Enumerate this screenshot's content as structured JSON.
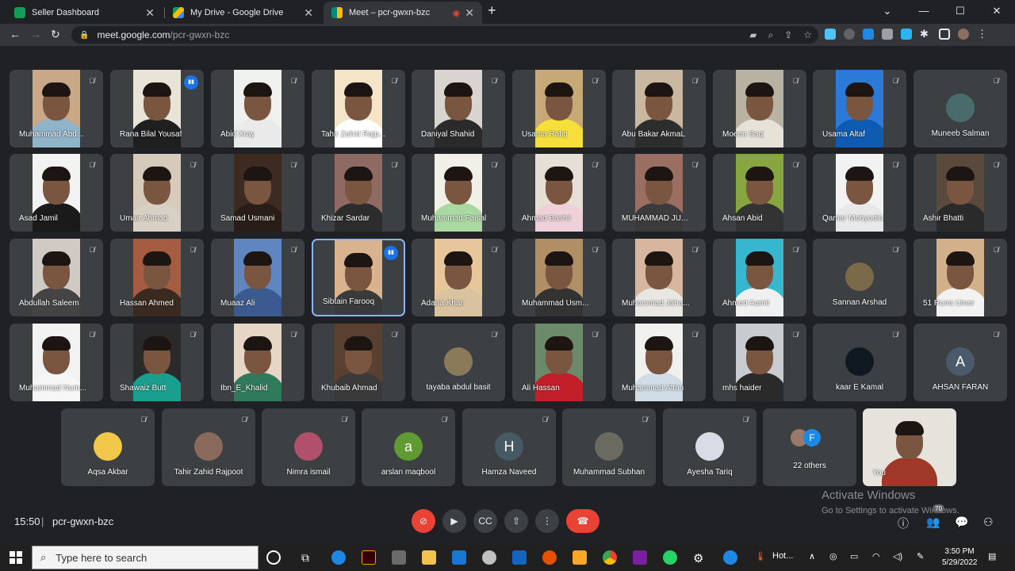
{
  "browser": {
    "tabs": [
      {
        "label": "Seller Dashboard",
        "favicon_color": "#0f9d58"
      },
      {
        "label": "My Drive - Google Drive",
        "favicon_color": "#fbbc04"
      },
      {
        "label": "Meet – pcr-gwxn-bzc",
        "favicon_color": "#00897b",
        "active": true
      }
    ],
    "url_host": "meet.google.com",
    "url_path": "/pcr-gwxn-bzc"
  },
  "meet": {
    "participants": [
      {
        "name": "Muhammad Abd...",
        "row": 1,
        "col": 1,
        "bg": "#c9a887",
        "shirt": "#8fb3c9"
      },
      {
        "name": "Rana Bilal Yousaf",
        "row": 1,
        "col": 2,
        "bg": "#e9e4d8",
        "shirt": "#1f1f1f",
        "speaking": true
      },
      {
        "name": "Abid Xray",
        "row": 1,
        "col": 3,
        "bg": "#f0f0ee",
        "shirt": "#eaeaea"
      },
      {
        "name": "Tahir Zahid Rajp...",
        "row": 1,
        "col": 4,
        "bg": "#f4e4c8",
        "shirt": "#ffffff"
      },
      {
        "name": "Daniyal Shahid",
        "row": 1,
        "col": 5,
        "bg": "#d8d4cf",
        "shirt": "#2a2a2a"
      },
      {
        "name": "Usama Rafiq",
        "row": 1,
        "col": 6,
        "bg": "#c7a978",
        "shirt": "#f6df3a"
      },
      {
        "name": "Abu Bakar AkmaL",
        "row": 1,
        "col": 7,
        "bg": "#c9b7a0",
        "shirt": "#2d2d2d"
      },
      {
        "name": "Moeen Saqi",
        "row": 1,
        "col": 8,
        "bg": "#b9b1a1",
        "shirt": "#e6e2d8"
      },
      {
        "name": "Usama Altaf",
        "row": 1,
        "col": 9,
        "bg": "#2b7ad9",
        "shirt": "#0e5bb3"
      },
      {
        "name": "Muneeb Salman",
        "row": 1,
        "col": 10,
        "avatar_color": "#4a6b6b"
      },
      {
        "name": "Asad Jamil",
        "row": 2,
        "col": 1,
        "bg": "#f2f2f2",
        "shirt": "#1a1a1a"
      },
      {
        "name": "Umair Ahmad",
        "row": 2,
        "col": 2,
        "bg": "#d6cabc",
        "shirt": "#d8d0c2"
      },
      {
        "name": "Samad Usmani",
        "row": 2,
        "col": 3,
        "bg": "#3d2b22",
        "shirt": "#2a1d17"
      },
      {
        "name": "Khizar Sardar",
        "row": 2,
        "col": 4,
        "bg": "#8e6a63",
        "shirt": "#2c2c2c"
      },
      {
        "name": "Muhammad Faisal",
        "row": 2,
        "col": 5,
        "bg": "#f0efe8",
        "shirt": "#a9d8a0"
      },
      {
        "name": "Ahmad Bashir",
        "row": 2,
        "col": 6,
        "bg": "#e6dfd6",
        "shirt": "#f0d0d8"
      },
      {
        "name": "MUHAMMAD JU...",
        "row": 2,
        "col": 7,
        "bg": "#9a6f62",
        "shirt": "#3b3b3b"
      },
      {
        "name": "Ahsan Abid",
        "row": 2,
        "col": 8,
        "bg": "#87a63f",
        "shirt": "#333333"
      },
      {
        "name": "Qamar Mohyodin",
        "row": 2,
        "col": 9,
        "bg": "#f2f2f2",
        "shirt": "#e8e8e8"
      },
      {
        "name": "Ashir Bhatti",
        "row": 2,
        "col": 10,
        "bg": "#5a4a3e",
        "shirt": "#2a2a2a"
      },
      {
        "name": "Abdullah Saleem",
        "row": 3,
        "col": 1,
        "bg": "#cfcac4",
        "shirt": "#444444"
      },
      {
        "name": "Hassan Ahmed",
        "row": 3,
        "col": 2,
        "bg": "#a65c40",
        "shirt": "#3a2a20"
      },
      {
        "name": "Muaaz Ali",
        "row": 3,
        "col": 3,
        "bg": "#5f86c0",
        "shirt": "#3b5a8f"
      },
      {
        "name": "Sibtain Farooq",
        "row": 3,
        "col": 4,
        "bg": "#d9b38e",
        "shirt": "#3a3a3a",
        "speaking": true,
        "selected": true
      },
      {
        "name": "Adana Khan",
        "row": 3,
        "col": 5,
        "bg": "#e7c69b",
        "shirt": "#d8c2a0"
      },
      {
        "name": "Muhammad Usm...",
        "row": 3,
        "col": 6,
        "bg": "#b08e66",
        "shirt": "#333333"
      },
      {
        "name": "Muhammad Jaha...",
        "row": 3,
        "col": 7,
        "bg": "#d7b6a0",
        "shirt": "#e9e7e2"
      },
      {
        "name": "Ahmed Aamir",
        "row": 3,
        "col": 8,
        "bg": "#36b7cf",
        "shirt": "#f0f0f0"
      },
      {
        "name": "Sannan Arshad",
        "row": 3,
        "col": 9,
        "avatar_color": "#7a6a4a"
      },
      {
        "name": "51 Runa Umer",
        "row": 3,
        "col": 10,
        "bg": "#d1b08a",
        "shirt": "#f2f2f2"
      },
      {
        "name": "Muhammad Num...",
        "row": 4,
        "col": 1,
        "bg": "#f2f2f2",
        "shirt": "#f6f6f6"
      },
      {
        "name": "Shawaiz Butt",
        "row": 4,
        "col": 2,
        "bg": "#2a2a2a",
        "shirt": "#1a9e8e"
      },
      {
        "name": "Ibn_E_Khalid",
        "row": 4,
        "col": 3,
        "bg": "#e6d6c6",
        "shirt": "#2f7a5a"
      },
      {
        "name": "Khubaib Ahmad",
        "row": 4,
        "col": 4,
        "bg": "#5a4030",
        "shirt": "#3a3a3a"
      },
      {
        "name": "tayaba abdul basit",
        "row": 4,
        "col": 5,
        "avatar_color": "#8a7a5a"
      },
      {
        "name": "Ali Hassan",
        "row": 4,
        "col": 6,
        "bg": "#6a8a6a",
        "shirt": "#c21f2a"
      },
      {
        "name": "Muhammad Affan",
        "row": 4,
        "col": 7,
        "bg": "#f0f0ee",
        "shirt": "#d0dce6"
      },
      {
        "name": "mhs haider",
        "row": 4,
        "col": 8,
        "bg": "#c8ccd0",
        "shirt": "#2a2a2a"
      },
      {
        "name": "kaar E Kamal",
        "row": 4,
        "col": 9,
        "avatar_color": "#101822"
      },
      {
        "name": "AHSAN FARAN",
        "row": 4,
        "col": 10,
        "avatar_letter": "A",
        "avatar_color": "#4a5a6a"
      },
      {
        "name": "Aqsa Akbar",
        "row": 5,
        "col": 1,
        "avatar_color": "#f2c84b"
      },
      {
        "name": "Tahir Zahid Rajpoot",
        "row": 5,
        "col": 2,
        "avatar_color": "#8a6a5a"
      },
      {
        "name": "Nimra ismail",
        "row": 5,
        "col": 3,
        "avatar_color": "#b0506a"
      },
      {
        "name": "arslan maqbool",
        "row": 5,
        "col": 4,
        "avatar_letter": "a",
        "avatar_color": "#5f9a33"
      },
      {
        "name": "Hamza Naveed",
        "row": 5,
        "col": 5,
        "avatar_letter": "H",
        "avatar_color": "#455a64"
      },
      {
        "name": "Muhammad Subhan",
        "row": 5,
        "col": 6,
        "avatar_color": "#6a6a60"
      },
      {
        "name": "Ayesha Tariq",
        "row": 5,
        "col": 7,
        "avatar_color": "#d8dce6"
      },
      {
        "name": "22 others",
        "row": 5,
        "col": 8,
        "avatar_letter": "F",
        "avatar_color": "#1e88e5",
        "others": true
      },
      {
        "name": "You",
        "row": 5,
        "col": 9,
        "bg": "#e6e2dc",
        "shirt": "#a0382a",
        "self": true
      }
    ],
    "time": "15:50",
    "meeting_code": "pcr-gwxn-bzc",
    "people_count": "70",
    "chat_badge": "4"
  },
  "windows": {
    "activate_title": "Activate Windows",
    "activate_sub": "Go to Settings to activate Windows.",
    "search_placeholder": "Type here to search",
    "weather": "Hot...",
    "clock_time": "3:50 PM",
    "clock_date": "5/29/2022"
  }
}
